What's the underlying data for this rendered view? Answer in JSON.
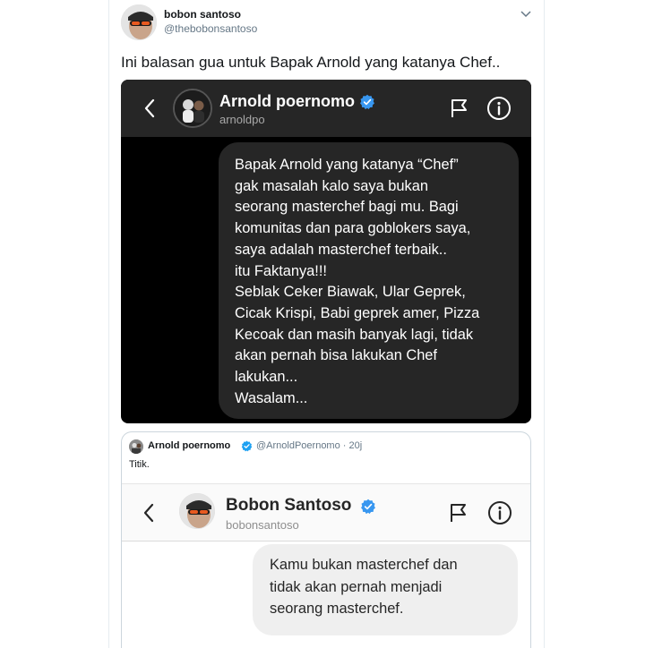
{
  "tweet": {
    "author_name": "bobon santoso",
    "author_handle": "@thebobonsantoso",
    "text": "Ini balasan gua untuk Bapak Arnold yang katanya Chef.."
  },
  "dm_dark": {
    "name": "Arnold poernomo",
    "handle": "arnoldpo",
    "message_lines": [
      "Bapak Arnold yang katanya “Chef”",
      "gak masalah kalo saya bukan",
      "seorang masterchef bagi mu. Bagi",
      "komunitas dan para goblokers saya,",
      "saya adalah masterchef terbaik..",
      "itu Faktanya!!!",
      "Seblak Ceker Biawak, Ular Geprek,",
      "Cicak Krispi, Babi geprek amer, Pizza",
      "Kecoak dan masih banyak lagi, tidak",
      "akan pernah bisa lakukan Chef",
      "lakukan...",
      "Wasalam..."
    ]
  },
  "quoted_tweet": {
    "author_name": "Arnold poernomo",
    "author_handle": "@ArnoldPoernomo · 20j",
    "text": "Titik.",
    "dm_light": {
      "name": "Bobon Santoso",
      "handle": "bobonsantoso",
      "message_lines": [
        "Kamu bukan masterchef dan",
        "tidak akan pernah menjadi",
        "seorang masterchef."
      ]
    }
  },
  "icons": {
    "verified": "verified-badge-icon",
    "back": "chevron-left-icon",
    "flag": "flag-icon",
    "info": "info-icon",
    "caret": "chevron-down-icon"
  },
  "colors": {
    "verified_blue": "#1da1f2",
    "ig_verified_blue": "#3897f0",
    "dark_bg": "#000000",
    "dark_bubble": "#262626",
    "light_bubble": "#efefef"
  }
}
